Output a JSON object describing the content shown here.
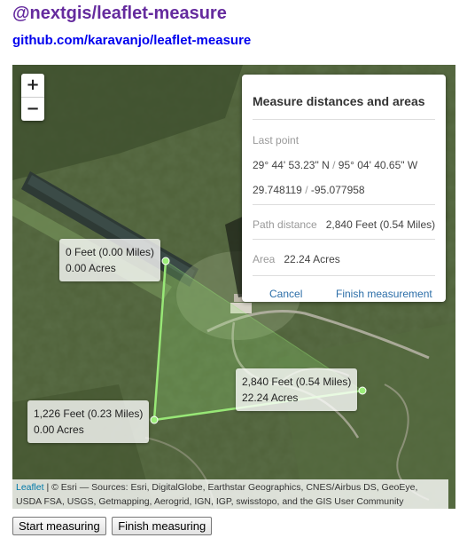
{
  "page": {
    "title": "@nextgis/leaflet-measure",
    "repo_link": "github.com/karavanjo/leaflet-measure"
  },
  "zoom": {
    "in": "+",
    "out": "−"
  },
  "panel": {
    "title": "Measure distances and areas",
    "last_point_label": "Last point",
    "dms_lat": "29° 44' 53.23\" N",
    "dms_sep": "/",
    "dms_lng": "95° 04' 40.65\" W",
    "dec_lat": "29.748119",
    "dec_sep": "/",
    "dec_lng": "-95.077958",
    "path_label": "Path distance",
    "path_value": "2,840 Feet (0.54 Miles)",
    "area_label": "Area",
    "area_value": "22.24 Acres",
    "cancel": "Cancel",
    "finish": "Finish measurement"
  },
  "tooltips": [
    {
      "distance": "0 Feet (0.00 Miles)",
      "area": "0.00 Acres"
    },
    {
      "distance": "1,226 Feet (0.23 Miles)",
      "area": "0.00 Acres"
    },
    {
      "distance": "2,840 Feet (0.54 Miles)",
      "area": "22.24 Acres"
    }
  ],
  "attribution": {
    "leaflet": "Leaflet",
    "text": " | © Esri — Sources: Esri, DigitalGlobe, Earthstar Geographics, CNES/Airbus DS, GeoEye, USDA FSA, USGS, Getmapping, Aerogrid, IGN, IGP, swisstopo, and the GIS User Community"
  },
  "controls": {
    "start": "Start measuring",
    "finish": "Finish measuring"
  },
  "colors": {
    "title": "#652b9e",
    "measure_line": "#9bed79",
    "panel_link": "#2c6ea8"
  }
}
